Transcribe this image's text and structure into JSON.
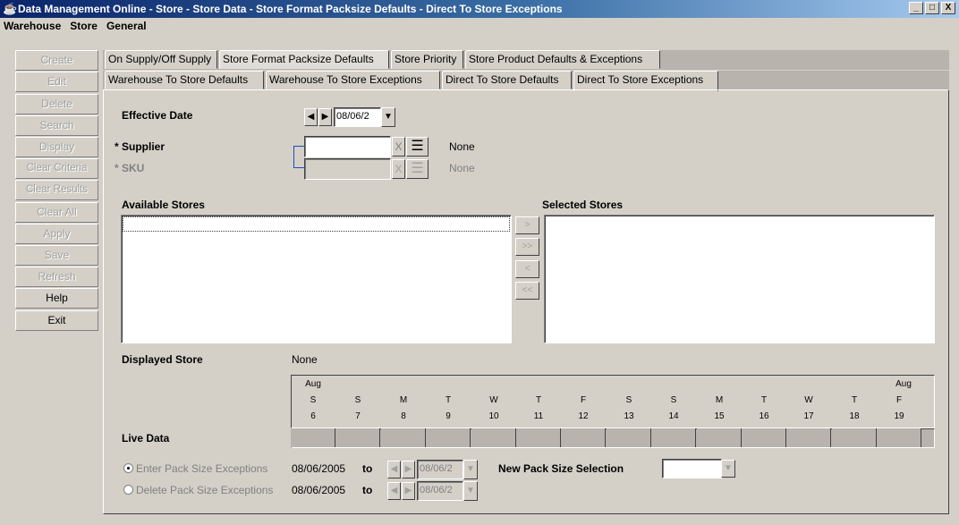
{
  "window": {
    "title": "Data Management Online - Store - Store Data - Store Format Packsize Defaults - Direct To Store Exceptions",
    "controls": [
      "_",
      "□",
      "X"
    ]
  },
  "menu": [
    "Warehouse",
    "Store",
    "General"
  ],
  "left_buttons": [
    {
      "label": "Create",
      "enabled": false
    },
    {
      "label": "Edit",
      "enabled": false
    },
    {
      "label": "Delete",
      "enabled": false
    },
    {
      "label": "Search",
      "enabled": false
    },
    {
      "label": "Display",
      "enabled": false
    },
    {
      "label": "Clear Criteria",
      "enabled": false
    },
    {
      "label": "Clear Results",
      "enabled": false
    },
    {
      "label": "Clear All",
      "enabled": false
    },
    {
      "label": "Apply",
      "enabled": false
    },
    {
      "label": "Save",
      "enabled": false
    },
    {
      "label": "Refresh",
      "enabled": false
    },
    {
      "label": "Help",
      "enabled": true
    },
    {
      "label": "Exit",
      "enabled": true
    }
  ],
  "tabs_top": [
    "On Supply/Off Supply",
    "Store Format Packsize Defaults",
    "Store Priority",
    "Store Product Defaults & Exceptions"
  ],
  "tabs_sub": [
    "Warehouse To Store Defaults",
    "Warehouse To Store Exceptions",
    "Direct To Store Defaults",
    "Direct To Store Exceptions"
  ],
  "form": {
    "effective_date_label": "Effective Date",
    "effective_date_value": "08/06/2",
    "supplier_label": "Supplier",
    "supplier_required": "*",
    "supplier_value": "",
    "supplier_desc": "None",
    "sku_label": "SKU",
    "sku_required": "*",
    "sku_value": "",
    "sku_desc": "None",
    "clear_glyph": "X",
    "available_stores_label": "Available Stores",
    "selected_stores_label": "Selected Stores",
    "move_buttons": [
      ">",
      ">>",
      "<",
      "<<"
    ],
    "displayed_store_label": "Displayed Store",
    "displayed_store_value": "None",
    "live_data_label": "Live Data"
  },
  "calendar": {
    "month_start": "Aug",
    "month_end": "Aug",
    "days": [
      {
        "dow": "S",
        "day": "6"
      },
      {
        "dow": "S",
        "day": "7"
      },
      {
        "dow": "M",
        "day": "8"
      },
      {
        "dow": "T",
        "day": "9"
      },
      {
        "dow": "W",
        "day": "10"
      },
      {
        "dow": "T",
        "day": "11"
      },
      {
        "dow": "F",
        "day": "12"
      },
      {
        "dow": "S",
        "day": "13"
      },
      {
        "dow": "S",
        "day": "14"
      },
      {
        "dow": "M",
        "day": "15"
      },
      {
        "dow": "T",
        "day": "16"
      },
      {
        "dow": "W",
        "day": "17"
      },
      {
        "dow": "T",
        "day": "18"
      },
      {
        "dow": "F",
        "day": "19"
      }
    ]
  },
  "exceptions": {
    "enter_label": "Enter Pack Size Exceptions",
    "enter_from": "08/06/2005",
    "enter_to_label": "to",
    "enter_to_value": "08/06/2",
    "delete_label": "Delete Pack Size Exceptions",
    "delete_from": "08/06/2005",
    "delete_to_label": "to",
    "delete_to_value": "08/06/2",
    "new_pack_label": "New Pack Size Selection",
    "new_pack_value": ""
  },
  "colors": {
    "titlebar": "#0a246a",
    "window": "#d4d0c8",
    "disabled_text": "#a0a0a0"
  }
}
